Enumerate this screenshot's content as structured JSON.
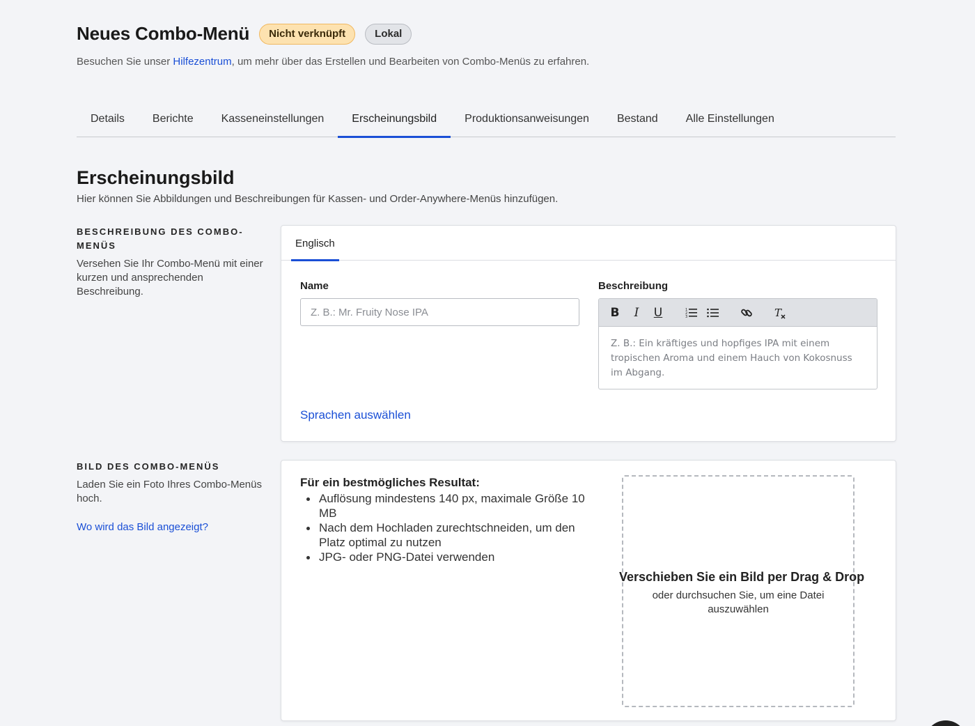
{
  "header": {
    "title": "Neues Combo-Menü",
    "badge_status": "Nicht verknüpft",
    "badge_scope": "Lokal",
    "subtitle_before": "Besuchen Sie unser ",
    "subtitle_link": "Hilfezentrum",
    "subtitle_after": ", um mehr über das Erstellen und Bearbeiten von Combo-Menüs zu erfahren."
  },
  "tabs": [
    {
      "label": "Details"
    },
    {
      "label": "Berichte"
    },
    {
      "label": "Kasseneinstellungen"
    },
    {
      "label": "Erscheinungsbild",
      "active": true
    },
    {
      "label": "Produktionsanweisungen"
    },
    {
      "label": "Bestand"
    },
    {
      "label": "Alle Einstellungen"
    }
  ],
  "section": {
    "title": "Erscheinungsbild",
    "subtitle": "Hier können Sie Abbildungen und Beschreibungen für Kassen- und Order-Anywhere-Menüs hinzufügen."
  },
  "description_block": {
    "heading": "BESCHREIBUNG DES COMBO-MENÜS",
    "text": "Versehen Sie Ihr Combo-Menü mit einer kurzen und ansprechenden Beschreibung.",
    "language_tab": "Englisch",
    "name_label": "Name",
    "name_placeholder": "Z. B.: Mr. Fruity Nose IPA",
    "description_label": "Beschreibung",
    "description_placeholder": "Z. B.: Ein kräftiges und hopfiges IPA mit einem tropischen Aroma und einem Hauch von Kokosnuss im Abgang.",
    "toolbar": [
      "bold-icon",
      "italic-icon",
      "underline-icon",
      "ordered-list-icon",
      "bullet-list-icon",
      "link-icon",
      "clear-format-icon"
    ],
    "languages_link": "Sprachen auswählen"
  },
  "image_block": {
    "heading": "BILD DES COMBO-MENÜS",
    "text": "Laden Sie ein Foto Ihres Combo-Menüs hoch.",
    "link": "Wo wird das Bild angezeigt?",
    "tips_title": "Für ein bestmögliches Resultat:",
    "tips": [
      "Auflösung mindestens 140 px, maximale Größe 10 MB",
      "Nach dem Hochladen zurechtschneiden, um den Platz optimal zu nutzen",
      "JPG- oder PNG-Datei verwenden"
    ],
    "dropzone_title": "Verschieben Sie ein Bild per Drag & Drop",
    "dropzone_sub": "oder durchsuchen Sie, um eine Datei auszuwählen"
  },
  "colors": {
    "accent": "#1a4fd6",
    "badge_warning_bg": "#fde2b0",
    "badge_neutral_bg": "#e2e4e8",
    "page_bg": "#f3f4f7"
  }
}
